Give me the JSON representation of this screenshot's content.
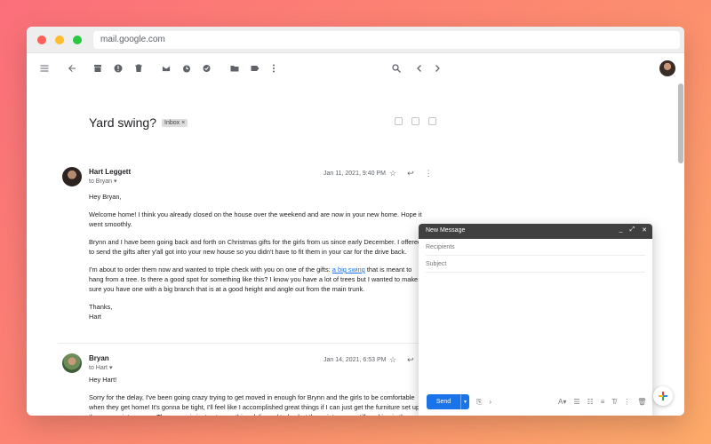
{
  "browser": {
    "url": "mail.google.com"
  },
  "toolbar": {
    "icons": [
      "menu-icon",
      "back-icon",
      "archive-icon",
      "report-spam-icon",
      "delete-icon",
      "mark-unread-icon",
      "snooze-icon",
      "add-to-tasks-icon",
      "move-to-icon",
      "labels-icon",
      "more-icon",
      "search-icon",
      "newer-icon",
      "older-icon"
    ]
  },
  "thread": {
    "subject": "Yard swing?",
    "label": "Inbox ×",
    "messages": [
      {
        "sender": "Hart Leggett",
        "to": "to Bryan ▾",
        "date": "Jan 11, 2021, 9:40 PM",
        "paragraphs": [
          "Hey Bryan,",
          "Welcome home! I think you already closed on the house over the weekend and are now in your new home. Hope it went smoothly.",
          "Brynn and I have been going back and forth on Christmas gifts for the girls from us since early December. I offered to send the gifts after y'all got into your new house so you didn't have to fit them in your car for the drive back.",
          "I'm about to order them now and wanted to triple check with you on one of the gifts: ",
          "that is meant to hang from a tree. Is there a good spot for something like this? I know you have a lot of trees but I wanted to make sure you have one with a big branch that is at a good height and angle out from the main trunk.",
          "Thanks,",
          "Hart"
        ],
        "link_text": "a big swing"
      },
      {
        "sender": "Bryan",
        "to": "to Hart ▾",
        "date": "Jan 14, 2021, 6:53 PM",
        "paragraphs": [
          "Hey Hart!",
          "Sorry for the delay, I've been going crazy trying to get moved in enough for Brynn and the girls to be comfortable when they get home! It's gonna be tight, I'll feel like I accomplished great things if I can just get the furniture set up in the appropriate rooms. The mover is just got everything delivered today but the painters are still working in three of the bedrooms and the hallway, so I had to have the movers leave all of the furniture in the master bedroom for now because that's the only room that's finished! If the painters do get finished tomorrow as they say they will I'll be able"
        ]
      }
    ]
  },
  "compose": {
    "title": "New Message",
    "recipients_placeholder": "Recipients",
    "subject_placeholder": "Subject",
    "send_label": "Send"
  }
}
